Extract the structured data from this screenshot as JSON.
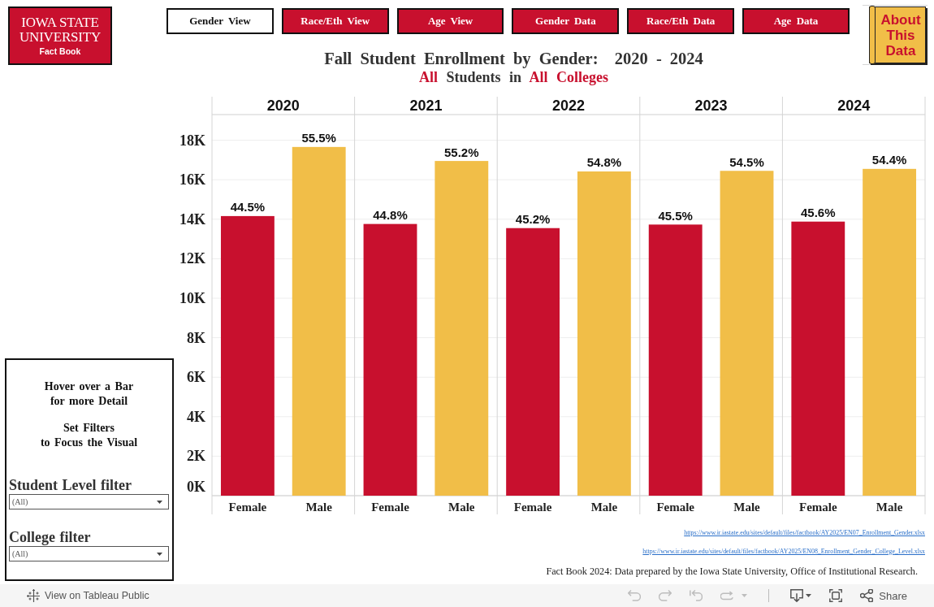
{
  "logo": {
    "wordmark": [
      "IOWA STATE",
      "UNIVERSITY"
    ],
    "caption": "Fact Book"
  },
  "nav_buttons": [
    {
      "label": "Gender View",
      "selected": true
    },
    {
      "label": "Race/Eth View",
      "selected": false
    },
    {
      "label": "Age View",
      "selected": false
    },
    {
      "label": "Gender Data",
      "selected": false
    },
    {
      "label": "Race/Eth Data",
      "selected": false
    },
    {
      "label": "Age Data",
      "selected": false
    }
  ],
  "about_button": {
    "label": "About This Data"
  },
  "title": "Fall Student Enrollment by Gender:  2020 - 2024",
  "subtitle": [
    {
      "text": "All",
      "highlight": true
    },
    {
      "text": "Students in",
      "highlight": false
    },
    {
      "text": "All Colleges",
      "highlight": true
    }
  ],
  "chart": {
    "chart_data": {
      "type": "bar",
      "categories": [
        "2020",
        "2021",
        "2022",
        "2023",
        "2024"
      ],
      "series": [
        {
          "name": "Female",
          "color": "#c8102e",
          "values": [
            14160,
            13760,
            13550,
            13730,
            13880
          ]
        },
        {
          "name": "Male",
          "color": "#f1be48",
          "values": [
            17660,
            16950,
            16420,
            16450,
            16550
          ]
        }
      ],
      "ylim": [
        0,
        19300
      ],
      "yticks": [
        {
          "value": 0,
          "label": "0K"
        },
        {
          "value": 2000,
          "label": "2K"
        },
        {
          "value": 4000,
          "label": "4K"
        },
        {
          "value": 6000,
          "label": "6K"
        },
        {
          "value": 8000,
          "label": "8K"
        },
        {
          "value": 10000,
          "label": "10K"
        },
        {
          "value": 12000,
          "label": "12K"
        },
        {
          "value": 14000,
          "label": "14K"
        },
        {
          "value": 16000,
          "label": "16K"
        },
        {
          "value": 18000,
          "label": "18K"
        }
      ],
      "grid": true,
      "annotations": [
        "44.5%",
        "55.5%",
        "44.8%",
        "55.2%",
        "45.2%",
        "54.8%",
        "45.5%",
        "54.5%",
        "45.6%",
        "54.4%"
      ]
    }
  },
  "instructions": [
    "Hover over a Bar\nfor more Detail",
    "Set Filters\nto Focus the Visual"
  ],
  "filters": [
    {
      "label": "Student Level filter",
      "value": "(All)"
    },
    {
      "label": "College filter",
      "value": "(All)"
    }
  ],
  "source_links": [
    "https://www.ir.iastate.edu/sites/default/files/factbook/AY2025/EN07_Enrollment_Gender.xlsx",
    "https://www.ir.iastate.edu/sites/default/files/factbook/AY2025/EN08_Enrollment_Gender_College_Level.xlsx"
  ],
  "footnote": "Fact Book 2024: Data prepared by the Iowa State University, Office of Institutional Research.",
  "toolbar": {
    "link": "View on Tableau Public",
    "actions": [
      {
        "kind": "undo",
        "disabled": true,
        "menu": false
      },
      {
        "kind": "redo",
        "disabled": true,
        "menu": false
      },
      {
        "kind": "revert",
        "disabled": true,
        "menu": false
      },
      {
        "kind": "refresh",
        "disabled": true,
        "menu": true
      },
      {
        "kind": "separator"
      },
      {
        "kind": "download",
        "disabled": false,
        "menu": true
      },
      {
        "kind": "fullscreen",
        "disabled": false,
        "menu": false
      },
      {
        "kind": "share",
        "disabled": false,
        "menu": false,
        "label": "Share"
      }
    ]
  }
}
